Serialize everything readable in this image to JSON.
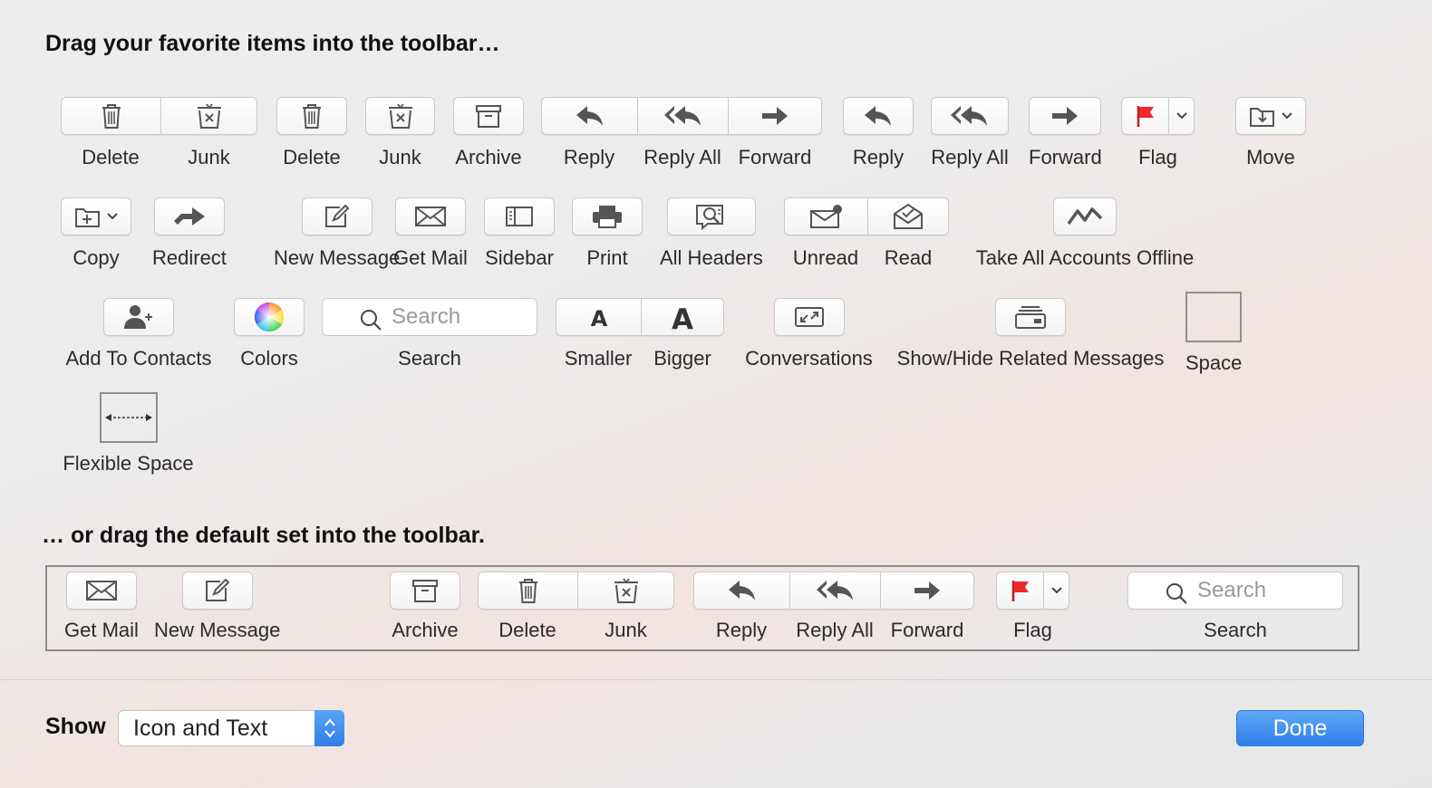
{
  "headings": {
    "favorites": "Drag your favorite items into the toolbar…",
    "default_set": "… or drag the default set into the toolbar."
  },
  "items": {
    "delete_junk_seg": [
      "Delete",
      "Junk"
    ],
    "delete": "Delete",
    "junk": "Junk",
    "archive": "Archive",
    "reply_seg": [
      "Reply",
      "Reply All",
      "Forward"
    ],
    "reply": "Reply",
    "reply_all": "Reply All",
    "forward": "Forward",
    "flag": "Flag",
    "move": "Move",
    "copy": "Copy",
    "redirect": "Redirect",
    "new_message": "New Message",
    "get_mail": "Get Mail",
    "sidebar": "Sidebar",
    "print": "Print",
    "all_headers": "All Headers",
    "unread_read_seg": [
      "Unread",
      "Read"
    ],
    "take_offline": "Take All Accounts Offline",
    "add_to_contacts": "Add To Contacts",
    "colors": "Colors",
    "search": "Search",
    "search_placeholder": "Search",
    "font_seg": [
      "Smaller",
      "Bigger"
    ],
    "conversations": "Conversations",
    "show_hide_related": "Show/Hide Related Messages",
    "space": "Space",
    "flexible_space": "Flexible Space"
  },
  "default_set": {
    "get_mail": "Get Mail",
    "new_message": "New Message",
    "archive": "Archive",
    "delete_junk_seg": [
      "Delete",
      "Junk"
    ],
    "reply_seg": [
      "Reply",
      "Reply All",
      "Forward"
    ],
    "flag": "Flag",
    "search": "Search",
    "search_placeholder": "Search"
  },
  "footer": {
    "show_label": "Show",
    "show_value": "Icon and Text",
    "done_label": "Done"
  },
  "colors": {
    "flag_red": "#f0282d",
    "accent_blue": "#2f7fe9"
  }
}
